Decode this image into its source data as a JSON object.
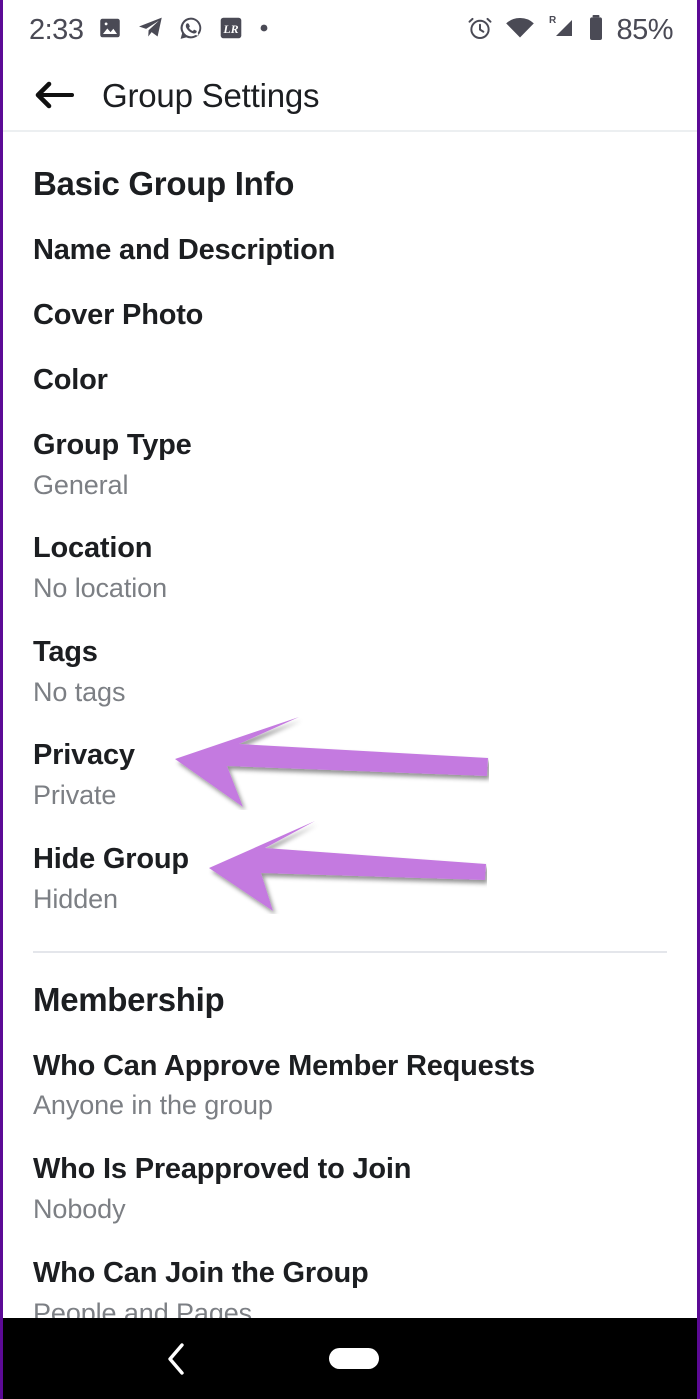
{
  "statusbar": {
    "time": "2:33",
    "battery_percent": "85%",
    "left_icons": [
      "photos-icon",
      "telegram-icon",
      "whatsapp-icon",
      "lightroom-icon",
      "dot-icon"
    ],
    "right_icons": [
      "alarm-icon",
      "wifi-icon",
      "cellular-signal-roaming-icon",
      "battery-icon"
    ]
  },
  "appbar": {
    "back_label": "back-arrow",
    "title": "Group Settings"
  },
  "sections": [
    {
      "header": "Basic Group Info",
      "rows": [
        {
          "title": "Name and Description",
          "sub": ""
        },
        {
          "title": "Cover Photo",
          "sub": ""
        },
        {
          "title": "Color",
          "sub": ""
        },
        {
          "title": "Group Type",
          "sub": "General"
        },
        {
          "title": "Location",
          "sub": "No location"
        },
        {
          "title": "Tags",
          "sub": "No tags"
        },
        {
          "title": "Privacy",
          "sub": "Private"
        },
        {
          "title": "Hide Group",
          "sub": "Hidden"
        }
      ]
    },
    {
      "header": "Membership",
      "rows": [
        {
          "title": "Who Can Approve Member Requests",
          "sub": "Anyone in the group"
        },
        {
          "title": "Who Is Preapproved to Join",
          "sub": "Nobody"
        },
        {
          "title": "Who Can Join the Group",
          "sub": "People and Pages"
        }
      ]
    }
  ],
  "annotations": [
    {
      "name": "privacy-callout-arrow",
      "color": "#c47ae0",
      "points_to": "Privacy"
    },
    {
      "name": "hide-group-callout-arrow",
      "color": "#c47ae0",
      "points_to": "Hide Group"
    }
  ],
  "navbar": {
    "back_icon": "chevron-left-icon",
    "home_icon": "home-pill-icon"
  },
  "colors": {
    "frame_border": "#5c0a96",
    "accent_arrow": "#c47ae0",
    "text_primary": "#1c1e21",
    "text_secondary": "#7c7f84",
    "divider": "#e4e6eb",
    "navbar_bg": "#000000"
  }
}
